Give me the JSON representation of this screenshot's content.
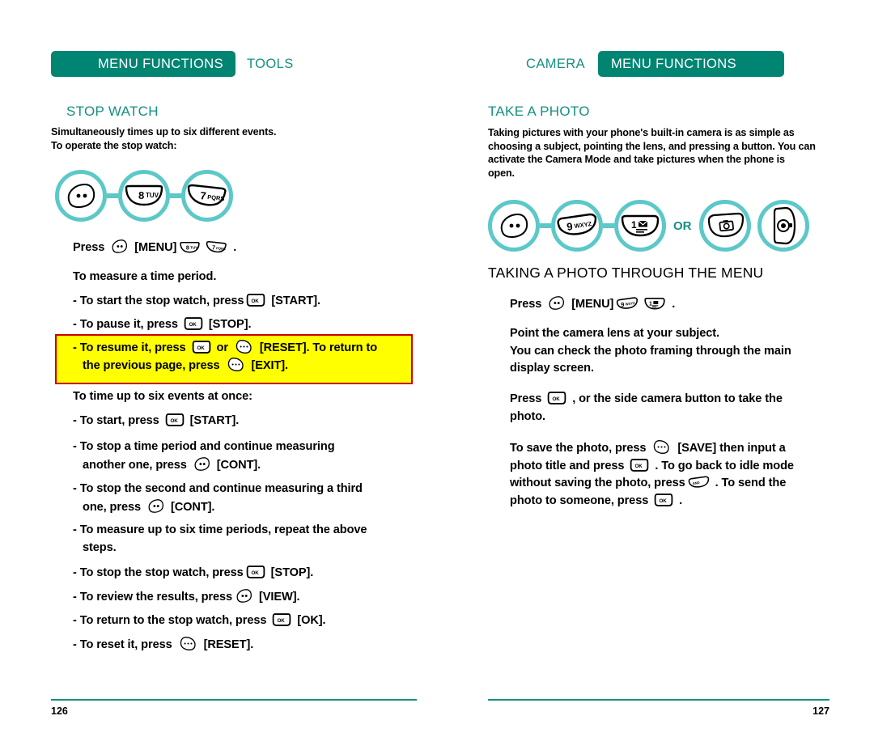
{
  "left_page": {
    "header": {
      "band": "MENU FUNCTIONS",
      "section": "TOOLS"
    },
    "title": "STOP WATCH",
    "intro": "Simultaneously times up to six different events.\nTo operate the stop watch:",
    "keyflow": [
      {
        "icon": "softkey-left-icon",
        "label": ""
      },
      {
        "icon": "key-8-icon",
        "label": "8 TUV"
      },
      {
        "icon": "key-7-icon",
        "label": "7 PQRS"
      }
    ],
    "press_line": {
      "press": "Press",
      "menu": "[MENU]",
      "period": "."
    },
    "measure_heading": "To measure a time period.",
    "steps_a": [
      {
        "pre": "- To start the stop watch, press",
        "key": "ok-key-icon",
        "post": "[START]."
      },
      {
        "pre": "- To pause it, press",
        "key": "ok-key-icon",
        "post": "[STOP]."
      }
    ],
    "highlight": {
      "line1_a": "- To resume it, press",
      "line1_key1": "ok-key-icon",
      "line1_mid": "or",
      "line1_key2": "softkey-right-icon",
      "line1_b": "[RESET]. To return to",
      "line2_a": "the previous page, press",
      "line2_key": "softkey-right-icon",
      "line2_b": "[EXIT]."
    },
    "six_heading": "To time up to six events at once:",
    "steps_b": [
      {
        "pre": "- To start, press",
        "key": "ok-key-icon",
        "post": "[START]."
      }
    ],
    "steps_wrap": [
      {
        "line1": "- To stop a time period and continue measuring",
        "line2_a": "another one, press",
        "key": "softkey-left-icon",
        "line2_b": "[CONT]."
      },
      {
        "line1": "- To stop the second and continue measuring a third",
        "line2_a": "one, press",
        "key": "softkey-left-icon",
        "line2_b": "[CONT]."
      }
    ],
    "steps_plain": [
      {
        "line1": "- To measure up to six time periods, repeat the above",
        "line2": "steps."
      }
    ],
    "steps_c": [
      {
        "pre": "- To stop the stop watch, press",
        "key": "ok-key-icon",
        "post": "[STOP]."
      },
      {
        "pre": "- To review the results, press",
        "key": "softkey-left-icon",
        "post": "[VIEW]."
      },
      {
        "pre": "- To return to the stop watch, press",
        "key": "ok-key-icon",
        "post": "[OK]."
      },
      {
        "pre": "- To reset it, press",
        "key": "softkey-right-icon",
        "post": "[RESET]."
      }
    ],
    "page_number": "126"
  },
  "right_page": {
    "header": {
      "band": "MENU FUNCTIONS",
      "section": "CAMERA"
    },
    "title": "TAKE A PHOTO",
    "intro": "Taking pictures with your phone's built-in camera is as simple as\nchoosing a subject, pointing the lens, and pressing a button. You can\nactivate the Camera Mode and take pictures when the phone is\nopen.",
    "keyflow": [
      {
        "icon": "softkey-left-icon",
        "label": ""
      },
      {
        "icon": "key-9-icon",
        "label": "9 WXYZ"
      },
      {
        "icon": "key-1-icon",
        "label": "1"
      }
    ],
    "or_label": "OR",
    "keyflow_alt": [
      {
        "icon": "camera-key-icon",
        "label": ""
      },
      {
        "icon": "side-camera-button-icon",
        "label": ""
      }
    ],
    "subtitle": "TAKING A PHOTO THROUGH THE MENU",
    "press_line": {
      "press": "Press",
      "menu": "[MENU]",
      "period": "."
    },
    "para_point": "Point the camera lens at your subject.\nYou can check the photo framing through the main\ndisplay screen.",
    "para_press": {
      "pre": "Press",
      "key": "ok-key-icon",
      "post": ", or the side camera button to take the",
      "line2": "photo."
    },
    "para_save": {
      "l1_a": "To save the photo, press",
      "l1_key": "softkey-right-icon",
      "l1_b": "[SAVE] then input a",
      "l2_a": "photo title and press",
      "l2_key": "ok-key-icon",
      "l2_b": ". To go back to idle mode",
      "l3_a": "without saving the photo, press",
      "l3_key": "end-key-icon",
      "l3_b": ". To send the",
      "l4_a": "photo to someone, press",
      "l4_key": "ok-key-icon",
      "l4_b": "."
    },
    "page_number": "127"
  },
  "colors": {
    "band_teal": "#008573",
    "heading_teal": "#16907f",
    "ring_teal": "#5cc8c8",
    "highlight_yellow": "#ffff00",
    "highlight_border": "#cc0000"
  }
}
